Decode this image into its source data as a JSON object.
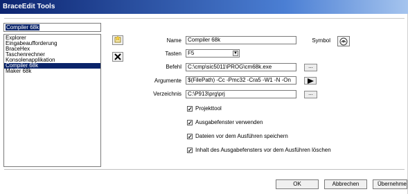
{
  "window": {
    "title": "BraceEdit Tools"
  },
  "tool_list": {
    "search_value": "Compiler 68k",
    "items": [
      {
        "label": "Explorer",
        "selected": false
      },
      {
        "label": "Eingabeaufforderung",
        "selected": false
      },
      {
        "label": "BraceHex",
        "selected": false
      },
      {
        "label": "Taschenrechner",
        "selected": false
      },
      {
        "label": "Konsolenapplikation",
        "selected": false
      },
      {
        "label": "Compiler 68k",
        "selected": true
      },
      {
        "label": "Maker 68k",
        "selected": false
      }
    ]
  },
  "toolbar": {
    "add_icon": "new-tool-icon",
    "delete_icon": "delete-tool-icon"
  },
  "form": {
    "name_label": "Name",
    "name_value": "Compiler 68k",
    "symbol_label": "Symbol",
    "tasten_label": "Tasten",
    "tasten_value": "F5",
    "befehl_label": "Befehl",
    "befehl_value": "C:\\cmp\\sic5011\\PROG\\cm68k.exe",
    "browse_label": "...",
    "argumente_label": "Argumente",
    "argumente_value": "$(FilePath) -Cc -Pmc32 -Cra5 -W1 -N -On",
    "verzeichnis_label": "Verzeichnis",
    "verzeichnis_value": "C:\\P913\\prg\\prj"
  },
  "options": [
    {
      "label": "Projekttool",
      "checked": true
    },
    {
      "label": "Ausgabefenster verwenden",
      "checked": true
    },
    {
      "label": "Dateien vor dem Ausführen speichern",
      "checked": true
    },
    {
      "label": "Inhalt des Ausgabefensters vor dem Ausführen löschen",
      "checked": true
    }
  ],
  "footer": {
    "ok_label": "OK",
    "cancel_label": "Abbrechen",
    "apply_label": "Übernehmen"
  }
}
